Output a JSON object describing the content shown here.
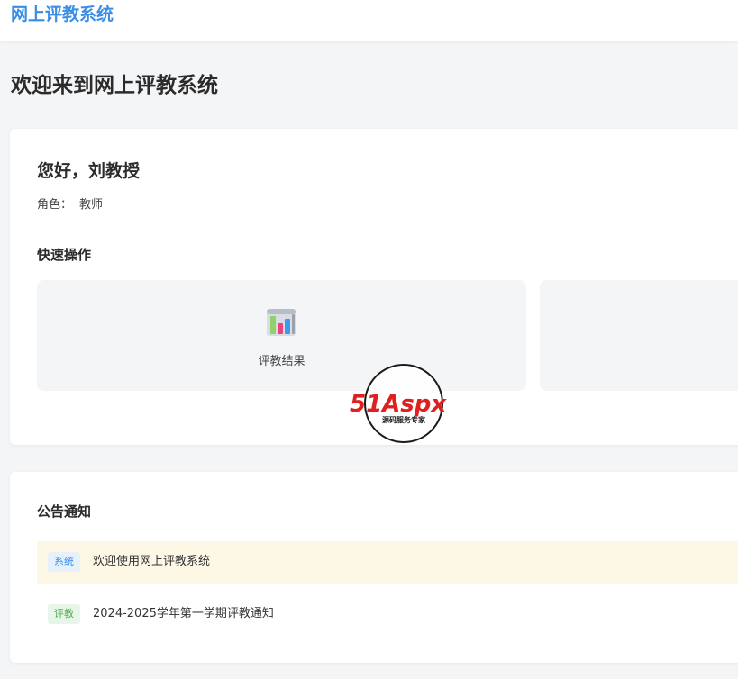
{
  "header": {
    "brand": "网上评教系统"
  },
  "page": {
    "title": "欢迎来到网上评教系统"
  },
  "welcome": {
    "greeting": "您好，刘教授",
    "role_label": "角色：",
    "role_value": "教师"
  },
  "quick_actions": {
    "title": "快速操作",
    "items": [
      {
        "label": "评教结果",
        "icon": "bar-chart-icon"
      },
      {
        "label": "",
        "icon": ""
      }
    ]
  },
  "notices": {
    "title": "公告通知",
    "items": [
      {
        "tag": "系统",
        "text": "欢迎使用网上评教系统",
        "highlight": "#fdf7e6"
      },
      {
        "tag": "评教",
        "text": "2024-2025学年第一学期评教通知"
      }
    ]
  },
  "watermark": {
    "text": "51Aspx",
    "subtext": "源码服务专家"
  },
  "colors": {
    "brand": "#3a8ee6",
    "tag_system": "#3a8ee6",
    "tag_eval": "#4caf50",
    "watermark_red": "#e02020",
    "watermark_green": "#33aa33"
  }
}
